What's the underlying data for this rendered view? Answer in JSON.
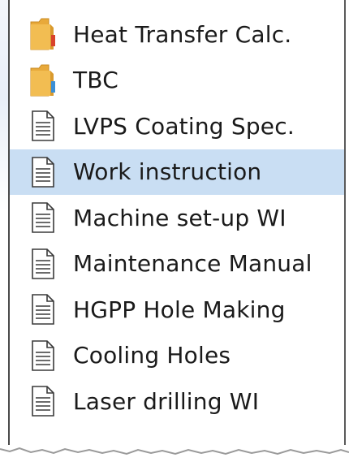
{
  "items": [
    {
      "label": "Heat Transfer Calc.",
      "icon": "folder-icon",
      "accent": "#d9432b",
      "selected": false
    },
    {
      "label": "TBC",
      "icon": "folder-icon",
      "accent": "#3b8fd6",
      "selected": false
    },
    {
      "label": "LVPS Coating Spec.",
      "icon": "document-icon",
      "selected": false
    },
    {
      "label": "Work instruction",
      "icon": "document-icon",
      "selected": true
    },
    {
      "label": "Machine set-up WI",
      "icon": "document-icon",
      "selected": false
    },
    {
      "label": "Maintenance Manual",
      "icon": "document-icon",
      "selected": false
    },
    {
      "label": "HGPP Hole Making",
      "icon": "document-icon",
      "selected": false
    },
    {
      "label": "Cooling Holes",
      "icon": "document-icon",
      "selected": false
    },
    {
      "label": "Laser drilling WI",
      "icon": "document-icon",
      "selected": false
    }
  ],
  "colors": {
    "selection": "#c9def3",
    "folder": "#e8a93a",
    "text": "#1a1a1a"
  }
}
